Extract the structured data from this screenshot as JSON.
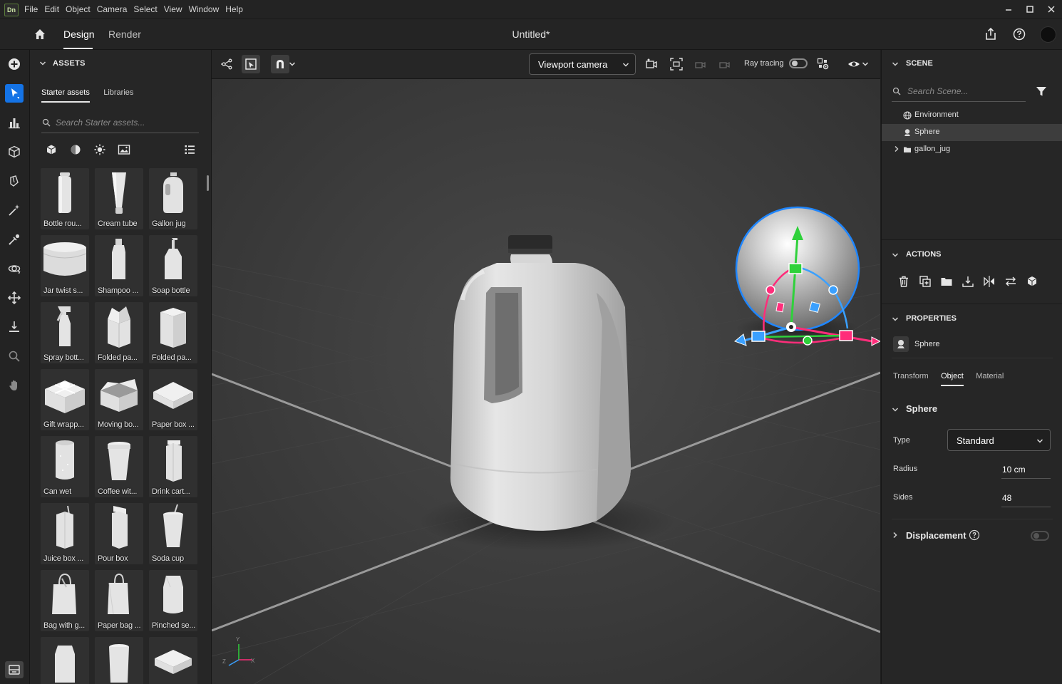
{
  "app": {
    "logo_text": "Dn",
    "menu": [
      "File",
      "Edit",
      "Object",
      "Camera",
      "Select",
      "View",
      "Window",
      "Help"
    ],
    "window_controls": [
      "minimize-icon",
      "maximize-icon",
      "close-icon"
    ]
  },
  "header": {
    "tabs": [
      "Design",
      "Render"
    ],
    "active_tab": "Design",
    "document_title": "Untitled*"
  },
  "tool_rail": {
    "tools": [
      "add-icon",
      "select-icon",
      "scene-chart-icon",
      "cube-icon",
      "paint-bucket-icon",
      "magic-wand-icon",
      "eyedropper-icon",
      "orbit-icon",
      "move-icon",
      "drop-to-ground-icon",
      "zoom-icon",
      "pan-hand-icon"
    ],
    "active_tool": "select-icon"
  },
  "assets": {
    "heading": "ASSETS",
    "tabs": [
      "Starter assets",
      "Libraries"
    ],
    "active_tab": "Starter assets",
    "search_placeholder": "Search Starter assets...",
    "items": [
      {
        "label": "Bottle rou..."
      },
      {
        "label": "Cream tube"
      },
      {
        "label": "Gallon jug"
      },
      {
        "label": "Jar twist s..."
      },
      {
        "label": "Shampoo ..."
      },
      {
        "label": "Soap bottle"
      },
      {
        "label": "Spray bott..."
      },
      {
        "label": "Folded pa..."
      },
      {
        "label": "Folded pa..."
      },
      {
        "label": "Gift wrapp..."
      },
      {
        "label": "Moving bo..."
      },
      {
        "label": "Paper box ..."
      },
      {
        "label": "Can wet"
      },
      {
        "label": "Coffee wit..."
      },
      {
        "label": "Drink cart..."
      },
      {
        "label": "Juice box ..."
      },
      {
        "label": "Pour box"
      },
      {
        "label": "Soda cup"
      },
      {
        "label": "Bag with g..."
      },
      {
        "label": "Paper bag ..."
      },
      {
        "label": "Pinched se..."
      },
      {
        "label": ""
      },
      {
        "label": ""
      },
      {
        "label": ""
      }
    ]
  },
  "viewport_toolbar": {
    "camera": "Viewport camera",
    "ray_tracing_label": "Ray tracing",
    "ray_tracing_on": false
  },
  "axis_gizmo": {
    "y": "Y",
    "x": "X",
    "z": "Z"
  },
  "scene": {
    "heading": "SCENE",
    "search_placeholder": "Search Scene...",
    "items": [
      {
        "label": "Environment",
        "selected": false
      },
      {
        "label": "Sphere",
        "selected": true
      },
      {
        "label": "gallon_jug",
        "selected": false
      }
    ]
  },
  "actions": {
    "heading": "ACTIONS",
    "buttons": [
      "delete-icon",
      "duplicate-icon",
      "group-folder-icon",
      "drop-to-ground-icon",
      "mirror-icon",
      "swap-icon",
      "replace-icon"
    ]
  },
  "properties": {
    "heading": "PROPERTIES",
    "object_name": "Sphere",
    "tabs": [
      "Transform",
      "Object",
      "Material"
    ],
    "active_tab": "Object",
    "group_title": "Sphere",
    "type_label": "Type",
    "type_value": "Standard",
    "radius_label": "Radius",
    "radius_value": "10 cm",
    "sides_label": "Sides",
    "sides_value": "48",
    "displacement_label": "Displacement",
    "displacement_on": false
  },
  "colors": {
    "accent": "#1473e6",
    "gizmo_y": "#2fd13b",
    "gizmo_x": "#ff2d7a",
    "gizmo_z": "#3aa0ff"
  }
}
